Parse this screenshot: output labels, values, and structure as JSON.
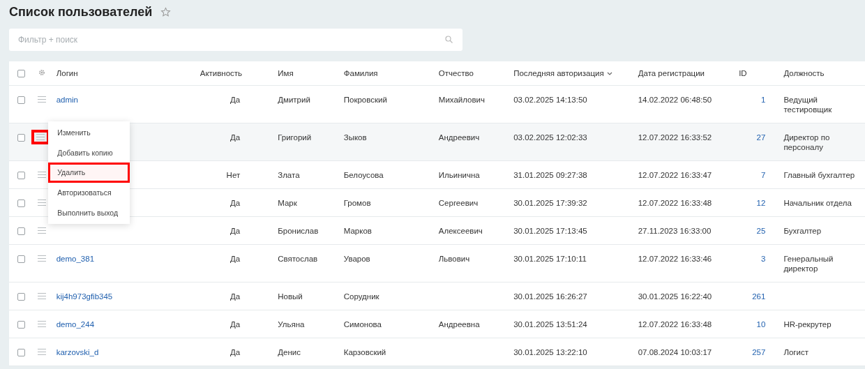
{
  "title": "Список пользователей",
  "favorite": false,
  "search": {
    "placeholder": "Фильтр + поиск"
  },
  "table": {
    "select_all_checked": false,
    "columns": [
      {
        "label": "Логин",
        "sorted": false
      },
      {
        "label": "Активность",
        "sorted": false
      },
      {
        "label": "Имя",
        "sorted": false
      },
      {
        "label": "Фамилия",
        "sorted": false
      },
      {
        "label": "Отчество",
        "sorted": false
      },
      {
        "label": "Последняя авторизация",
        "sorted": true
      },
      {
        "label": "Дата регистрации",
        "sorted": false
      },
      {
        "label": "ID",
        "sorted": false
      },
      {
        "label": "Должность",
        "sorted": false
      }
    ],
    "rows": [
      {
        "checked": false,
        "menu_open": false,
        "login": "admin",
        "active": "Да",
        "first": "Дмитрий",
        "last": "Покровский",
        "middle": "Михайлович",
        "last_login": "03.02.2025 14:13:50",
        "registered": "14.02.2022 06:48:50",
        "id": "1",
        "position": "Ведущий тестировщик"
      },
      {
        "checked": false,
        "menu_open": true,
        "active": "Да",
        "first": "Григорий",
        "last": "Зыков",
        "middle": "Андреевич",
        "last_login": "03.02.2025 12:02:33",
        "registered": "12.07.2022 16:33:52",
        "id": "27",
        "position": "Директор по персоналу"
      },
      {
        "checked": false,
        "menu_open": false,
        "active": "Нет",
        "first": "Злата",
        "last": "Белоусова",
        "middle": "Ильинична",
        "last_login": "31.01.2025 09:27:38",
        "registered": "12.07.2022 16:33:47",
        "id": "7",
        "position": "Главный бухгалтер"
      },
      {
        "checked": false,
        "menu_open": false,
        "active": "Да",
        "first": "Марк",
        "last": "Громов",
        "middle": "Сергеевич",
        "last_login": "30.01.2025 17:39:32",
        "registered": "12.07.2022 16:33:48",
        "id": "12",
        "position": "Начальник отдела"
      },
      {
        "checked": false,
        "menu_open": false,
        "active": "Да",
        "first": "Бронислав",
        "last": "Марков",
        "middle": "Алексеевич",
        "last_login": "30.01.2025 17:13:45",
        "registered": "27.11.2023 16:33:00",
        "id": "25",
        "position": "Бухгалтер"
      },
      {
        "checked": false,
        "menu_open": false,
        "login": "demo_381",
        "active": "Да",
        "first": "Святослав",
        "last": "Уваров",
        "middle": "Львович",
        "last_login": "30.01.2025 17:10:11",
        "registered": "12.07.2022 16:33:46",
        "id": "3",
        "position": "Генеральный директор"
      },
      {
        "checked": false,
        "menu_open": false,
        "login": "kij4h973gfib345",
        "active": "Да",
        "first": "Новый",
        "last": "Сорудник",
        "last_login": "30.01.2025 16:26:27",
        "registered": "30.01.2025 16:22:40",
        "id": "261"
      },
      {
        "checked": false,
        "menu_open": false,
        "login": "demo_244",
        "active": "Да",
        "first": "Ульяна",
        "last": "Симонова",
        "middle": "Андреевна",
        "last_login": "30.01.2025 13:51:24",
        "registered": "12.07.2022 16:33:48",
        "id": "10",
        "position": "HR-рекрутер"
      },
      {
        "checked": false,
        "menu_open": false,
        "login": "karzovski_d",
        "active": "Да",
        "first": "Денис",
        "last": "Карзовский",
        "last_login": "30.01.2025 13:22:10",
        "registered": "07.08.2024 10:03:17",
        "id": "257",
        "position": "Логист"
      }
    ]
  },
  "row_menu": {
    "items": [
      {
        "label": "Изменить",
        "highlighted": false
      },
      {
        "label": "Добавить копию",
        "highlighted": false
      },
      {
        "label": "Удалить",
        "highlighted": true
      },
      {
        "label": "Авторизоваться",
        "highlighted": false
      },
      {
        "label": "Выполнить выход",
        "highlighted": false
      }
    ]
  }
}
